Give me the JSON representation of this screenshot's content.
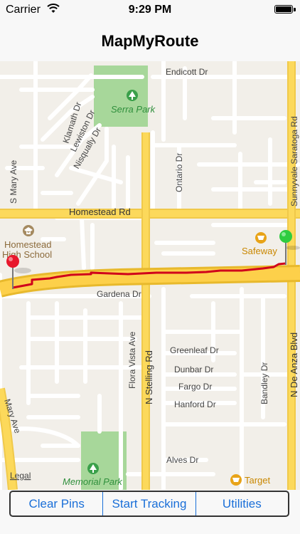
{
  "status_bar": {
    "carrier": "Carrier",
    "time": "9:29 PM"
  },
  "nav": {
    "title": "MapMyRoute"
  },
  "map": {
    "streets": {
      "endicott": "Endicott Dr",
      "klamath": "Klamath Dr",
      "lewiston": "Lewiston Dr",
      "nisqually": "Nisqually Dr",
      "s_mary": "S Mary Ave",
      "ontario": "Ontario Dr",
      "sunnyvale_saratoga": "Sunnyvale Saratoga Rd",
      "homestead": "Homestead Rd",
      "gardena": "Gardena Dr",
      "flora_vista": "Flora Vista Ave",
      "n_stelling": "N Stelling Rd",
      "greenleaf": "Greenleaf Dr",
      "dunbar": "Dunbar Dr",
      "fargo": "Fargo Dr",
      "hanford": "Hanford Dr",
      "bandley": "Bandley Dr",
      "n_de_anza": "N De Anza Blvd",
      "mary": "Mary Ave",
      "alves": "Alves Dr"
    },
    "pois": {
      "serra_park": "Serra Park",
      "homestead_school_1": "Homestead",
      "homestead_school_2": "High School",
      "safeway": "Safeway",
      "memorial_park": "Memorial Park",
      "target": "Target"
    },
    "legal": "Legal",
    "colors": {
      "route": "#d0021b",
      "start_pin": "#2ecc40",
      "end_pin": "#e8182c",
      "park": "#a7d79a",
      "major_road": "#fcd95b"
    }
  },
  "toolbar": {
    "clear_pins": "Clear Pins",
    "start_tracking": "Start Tracking",
    "utilities": "Utilities"
  }
}
